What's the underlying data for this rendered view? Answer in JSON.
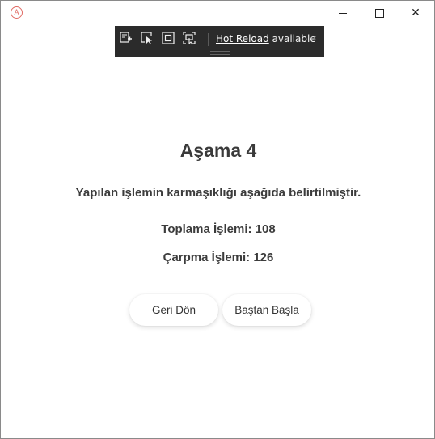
{
  "titlebar": {
    "app_icon_glyph": "A",
    "close_glyph": "✕"
  },
  "debug_toolbar": {
    "icons": [
      "live-visual-tree-icon",
      "select-element-icon",
      "display-layout-adorners-icon",
      "track-focus-icon"
    ],
    "hot_reload_label": "Hot Reload",
    "available_label": " available",
    "collapse_glyph": "‹"
  },
  "content": {
    "title": "Aşama 4",
    "description": "Yapılan işlemin karmaşıklığı aşağıda belirtilmiştir.",
    "addition_text": "Toplama İşlemi: 108",
    "multiplication_text": "Çarpma İşlemi: 126"
  },
  "buttons": {
    "back_label": "Geri Dön",
    "restart_label": "Baştan Başla"
  }
}
